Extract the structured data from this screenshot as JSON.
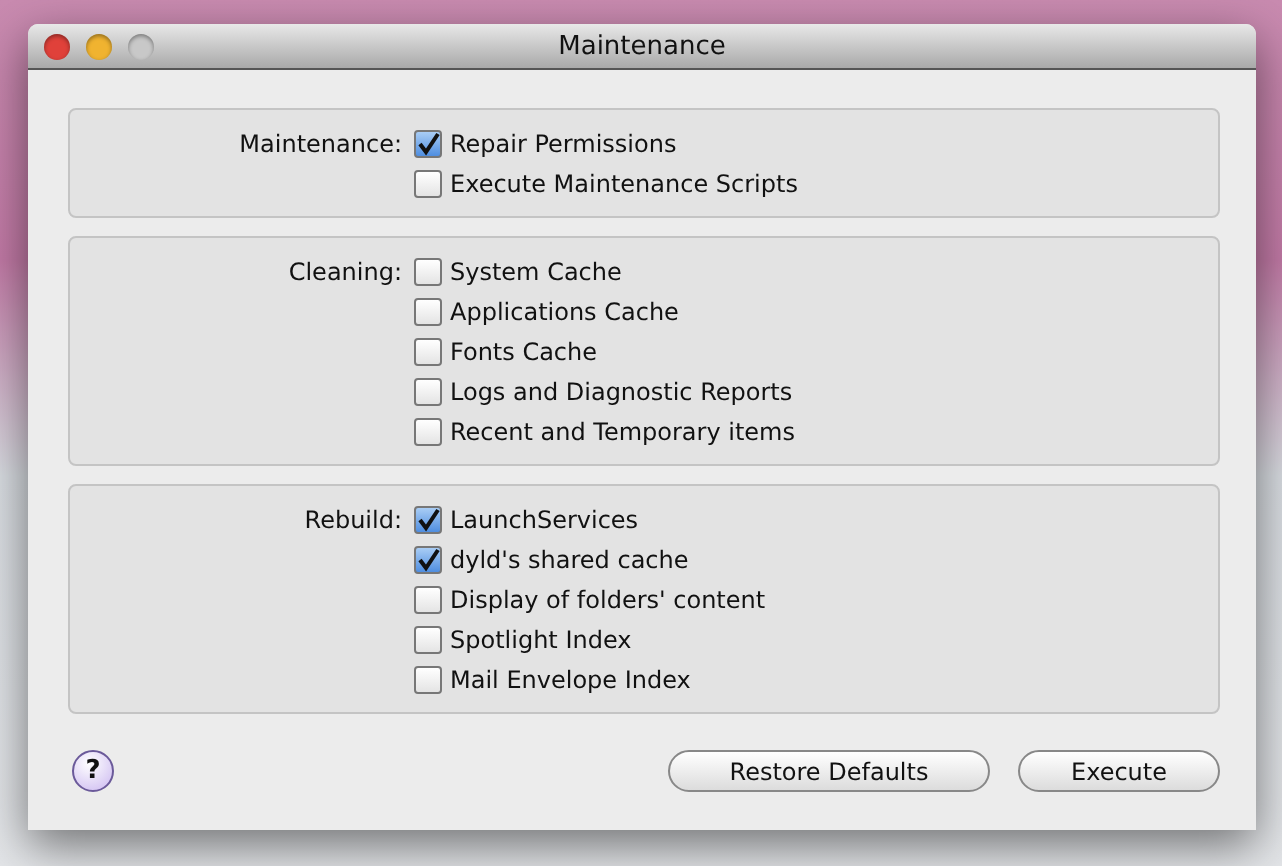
{
  "window": {
    "title": "Maintenance"
  },
  "groups": [
    {
      "label": "Maintenance:",
      "options": [
        {
          "label": "Repair Permissions",
          "checked": true
        },
        {
          "label": "Execute Maintenance Scripts",
          "checked": false
        }
      ]
    },
    {
      "label": "Cleaning:",
      "options": [
        {
          "label": "System Cache",
          "checked": false
        },
        {
          "label": "Applications Cache",
          "checked": false
        },
        {
          "label": "Fonts Cache",
          "checked": false
        },
        {
          "label": "Logs and Diagnostic Reports",
          "checked": false
        },
        {
          "label": "Recent and Temporary items",
          "checked": false
        }
      ]
    },
    {
      "label": "Rebuild:",
      "options": [
        {
          "label": "LaunchServices",
          "checked": true
        },
        {
          "label": "dyld's shared cache",
          "checked": true
        },
        {
          "label": "Display of folders' content",
          "checked": false
        },
        {
          "label": "Spotlight Index",
          "checked": false
        },
        {
          "label": "Mail Envelope Index",
          "checked": false
        }
      ]
    }
  ],
  "help": {
    "symbol": "?"
  },
  "buttons": [
    "Restore Defaults",
    "Execute"
  ]
}
